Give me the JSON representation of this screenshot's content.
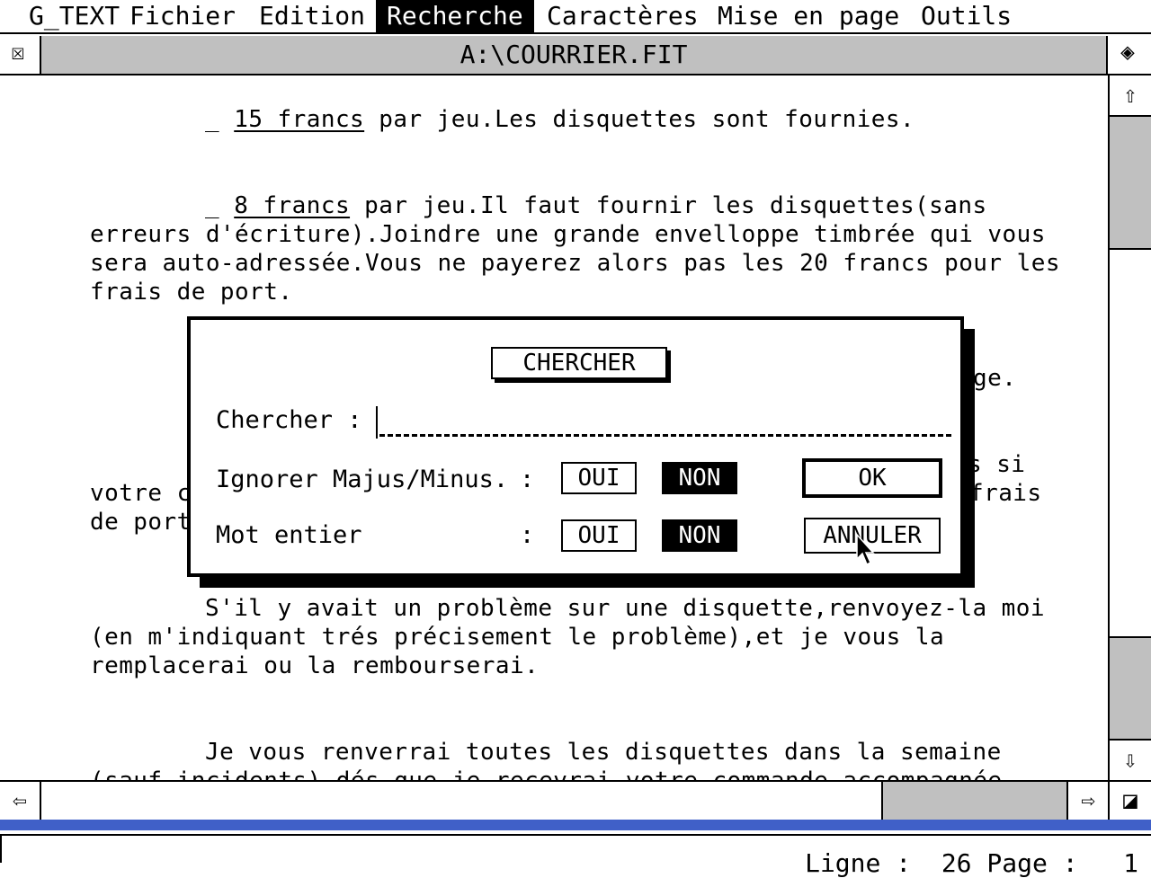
{
  "menubar": {
    "items": [
      "G_TEXT",
      "Fichier",
      "Edition",
      "Recherche",
      "Caractères",
      "Mise en page",
      "Outils"
    ],
    "active_index": 3
  },
  "window": {
    "title": "A:\\COURRIER.FIT",
    "close_glyph": "☒",
    "full_glyph": "◈",
    "up_glyph": "⇧",
    "down_glyph": "⇩",
    "left_glyph": "⇦",
    "right_glyph": "⇨",
    "size_glyph": "◪"
  },
  "document": {
    "l1_dash": "_ ",
    "l1_u": "15 francs",
    "l1_rest": " par jeu.Les disquettes sont fournies.",
    "l2_dash": "_ ",
    "l2_u": "8 francs",
    "l2_rest": " par jeu.Il faut fournir les disquettes(sans",
    "l3": "erreurs d'écriture).Joindre une grande envelloppe timbrée qui vous",
    "l4": "sera auto-adressée.Vous ne payerez alors pas les 20 francs pour les",
    "l5": "frais de port.",
    "frag1": "ge.",
    "frag2": "s si",
    "frag3a": "votre c",
    "frag3b": "frais",
    "frag4": "de port",
    "l6": "S'il y avait un problème sur une disquette,renvoyez-la moi",
    "l7": "(en m'indiquant trés précisement le problème),et je vous la",
    "l8": "remplacerai ou la rembourserai.",
    "l9": "Je vous renverrai toutes les disquettes dans la semaine",
    "l10": "(sauf incidents) dés que je recevrai votre commande accompagnée"
  },
  "dialog": {
    "title": "CHERCHER",
    "search_label": "Chercher :",
    "search_value": "",
    "case_label": "Ignorer Majus/Minus.",
    "word_label": "Mot entier",
    "colon": ":",
    "yes": "OUI",
    "no": "NON",
    "case_selected": "NON",
    "word_selected": "NON",
    "ok": "OK",
    "cancel": "ANNULER"
  },
  "status": {
    "line_label": "Ligne :",
    "line_value": "26",
    "page_label": "Page :",
    "page_value": "1"
  },
  "colors": {
    "status_accent": "#4060c8",
    "gray": "#c0c0c0"
  }
}
